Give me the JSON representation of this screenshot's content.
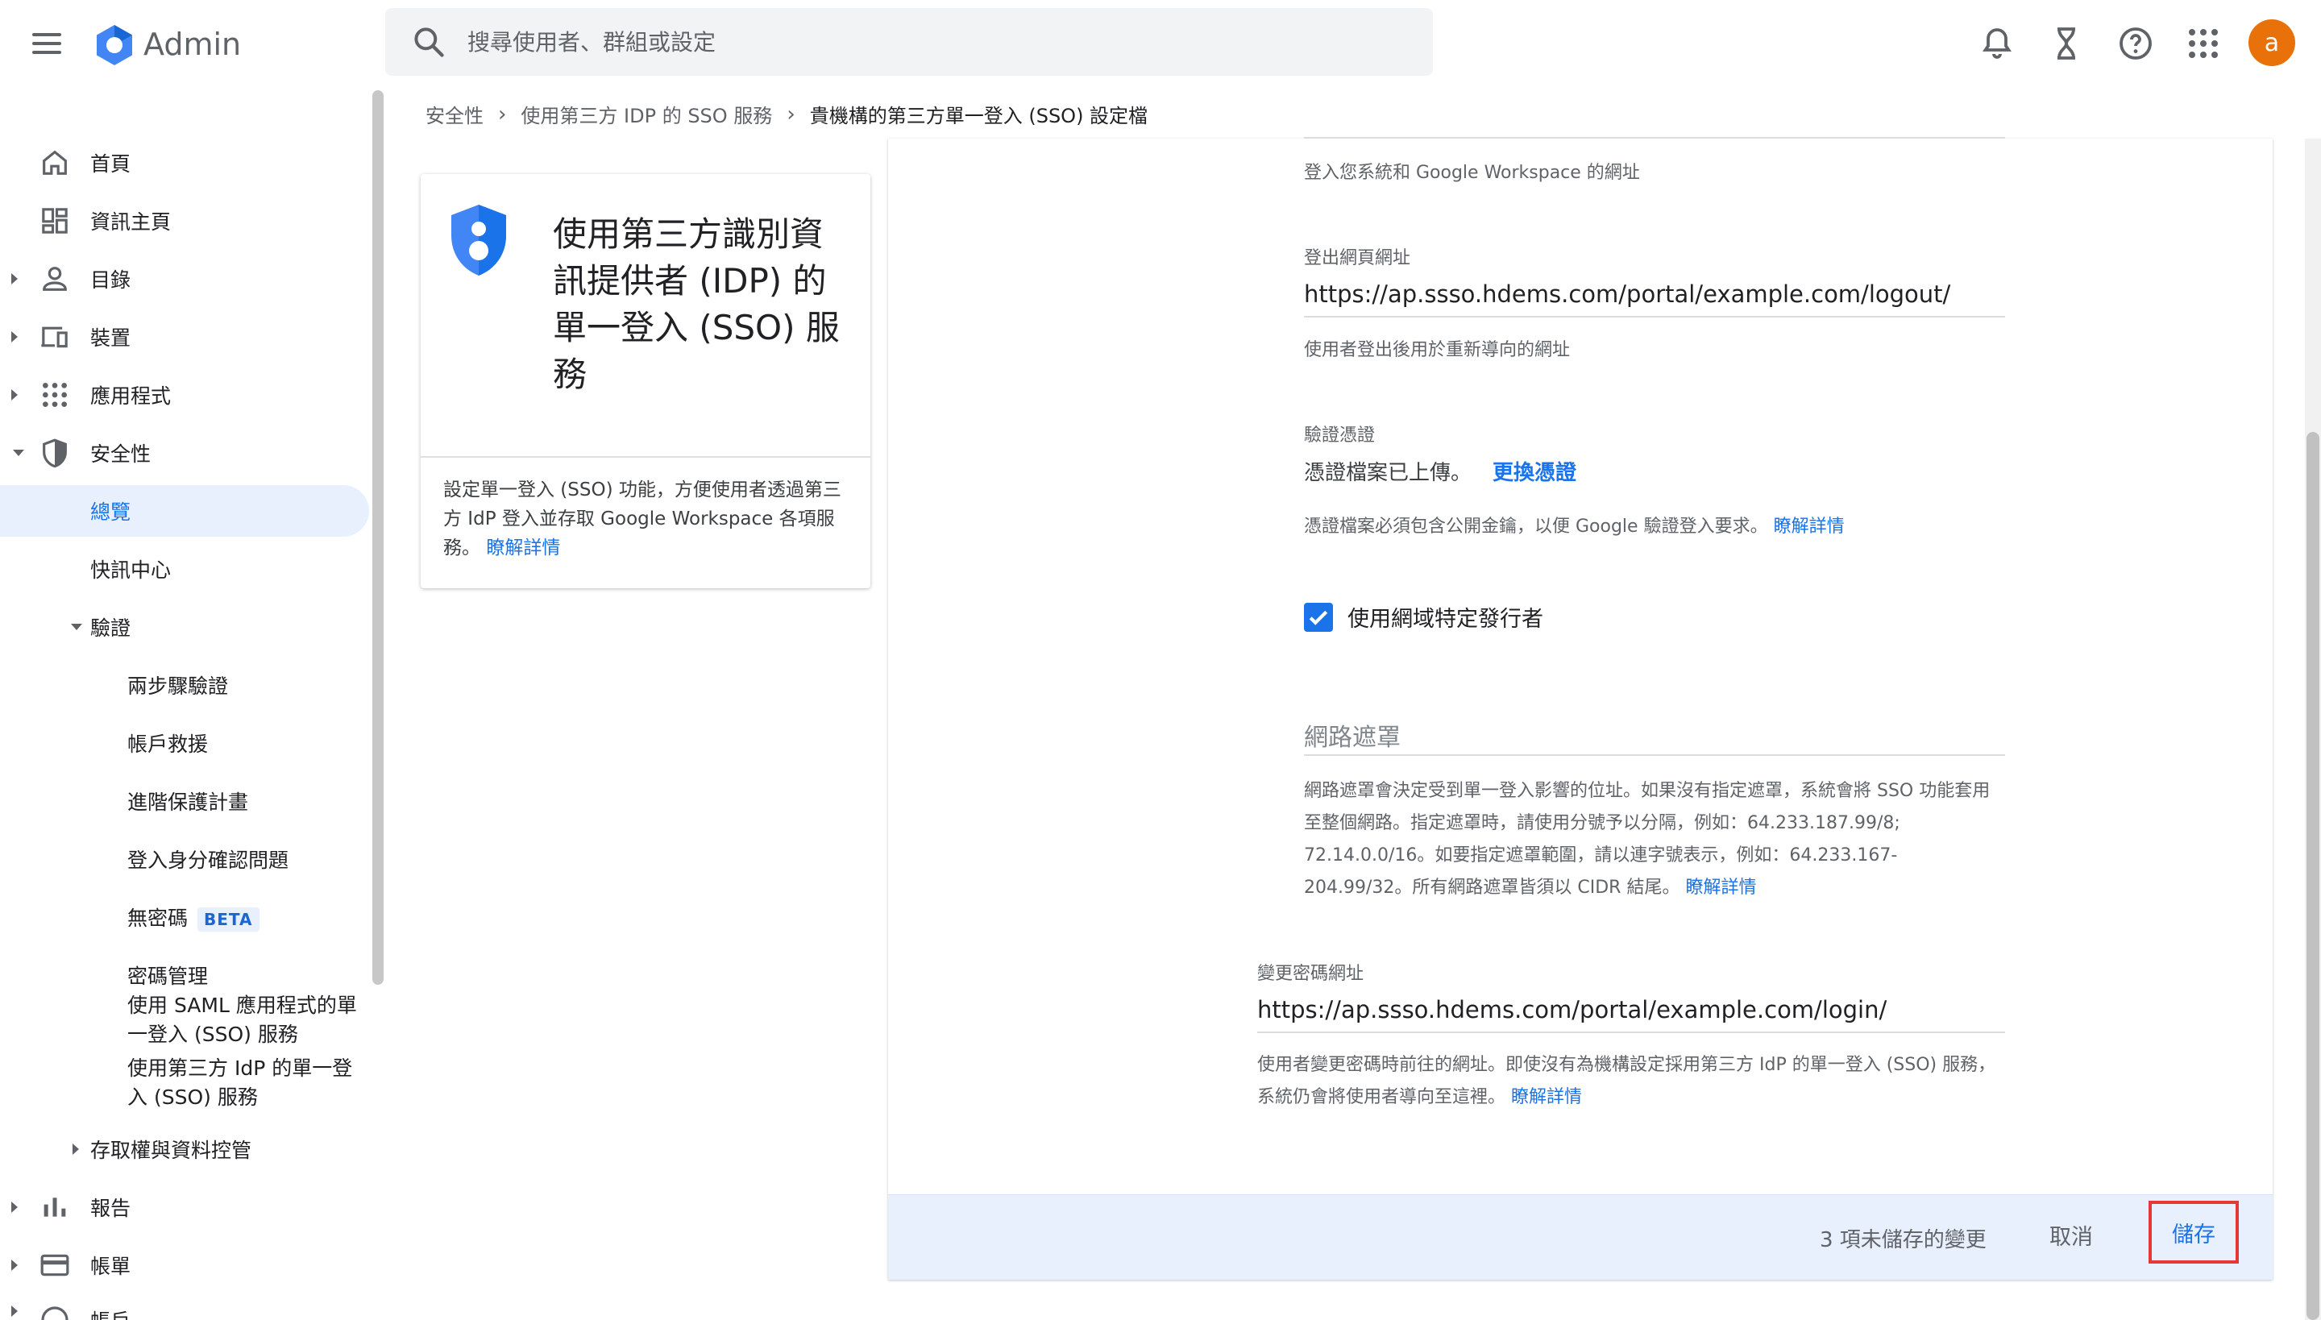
{
  "app": {
    "title": "Admin",
    "avatar_letter": "a"
  },
  "search": {
    "placeholder": "搜尋使用者、群組或設定"
  },
  "header_icons": [
    "bell-icon",
    "hourglass-icon",
    "help-icon",
    "apps-grid-icon"
  ],
  "sidebar": {
    "items": [
      {
        "label": "首頁"
      },
      {
        "label": "資訊主頁"
      },
      {
        "label": "目錄"
      },
      {
        "label": "裝置"
      },
      {
        "label": "應用程式"
      },
      {
        "label": "安全性"
      },
      {
        "label": "總覽"
      },
      {
        "label": "快訊中心"
      },
      {
        "label": "驗證"
      },
      {
        "label": "兩步驟驗證"
      },
      {
        "label": "帳戶救援"
      },
      {
        "label": "進階保護計畫"
      },
      {
        "label": "登入身分確認問題"
      },
      {
        "label": "無密碼",
        "badge": "BETA"
      },
      {
        "label": "密碼管理"
      },
      {
        "label": "使用 SAML 應用程式的單一登入 (SSO) 服務"
      },
      {
        "label": "使用第三方 IdP 的單一登入 (SSO) 服務"
      },
      {
        "label": "存取權與資料控管"
      },
      {
        "label": "報告"
      },
      {
        "label": "帳單"
      },
      {
        "label": "帳戶"
      }
    ]
  },
  "breadcrumb": [
    "安全性",
    "使用第三方 IDP 的 SSO 服務",
    "貴機構的第三方單一登入 (SSO) 設定檔"
  ],
  "info_card": {
    "title": "使用第三方識別資訊提供者 (IDP) 的單一登入 (SSO) 服務",
    "description": "設定單一登入 (SSO) 功能，方便使用者透過第三方 IdP 登入並存取 Google Workspace 各項服務。",
    "link": "瞭解詳情"
  },
  "form": {
    "signin_hint": "登入您系統和 Google Workspace 的網址",
    "logout_label": "登出網頁網址",
    "logout_value": "https://ap.ssso.hdems.com/portal/example.com/logout/",
    "logout_hint": "使用者登出後用於重新導向的網址",
    "cert_label": "驗證憑證",
    "cert_status": "憑證檔案已上傳。",
    "cert_replace": "更換憑證",
    "cert_hint": "憑證檔案必須包含公開金鑰，以便 Google 驗證登入要求。",
    "cert_hint_link": "瞭解詳情",
    "domain_issuer_label": "使用網域特定發行者",
    "domain_issuer_checked": true,
    "netmask_title": "網路遮罩",
    "netmask_hint": "網路遮罩會決定受到單一登入影響的位址。如果沒有指定遮罩，系統會將 SSO 功能套用至整個網路。指定遮罩時，請使用分號予以分隔，例如：64.233.187.99/8; 72.14.0.0/16。如要指定遮罩範圍，請以連字號表示，例如：64.233.167-204.99/32。所有網路遮罩皆須以 CIDR 結尾。",
    "netmask_link": "瞭解詳情",
    "change_pw_label": "變更密碼網址",
    "change_pw_value": "https://ap.ssso.hdems.com/portal/example.com/login/",
    "change_pw_hint": "使用者變更密碼時前往的網址。即使沒有為機構設定採用第三方 IdP 的單一登入 (SSO) 服務，系統仍會將使用者導向至這裡。",
    "change_pw_link": "瞭解詳情"
  },
  "actions": {
    "unsaved": "3 項未儲存的變更",
    "cancel": "取消",
    "save": "儲存"
  },
  "colors": {
    "accent": "#1a73e8",
    "avatar": "#e8710a",
    "highlight_border": "#e53935"
  }
}
